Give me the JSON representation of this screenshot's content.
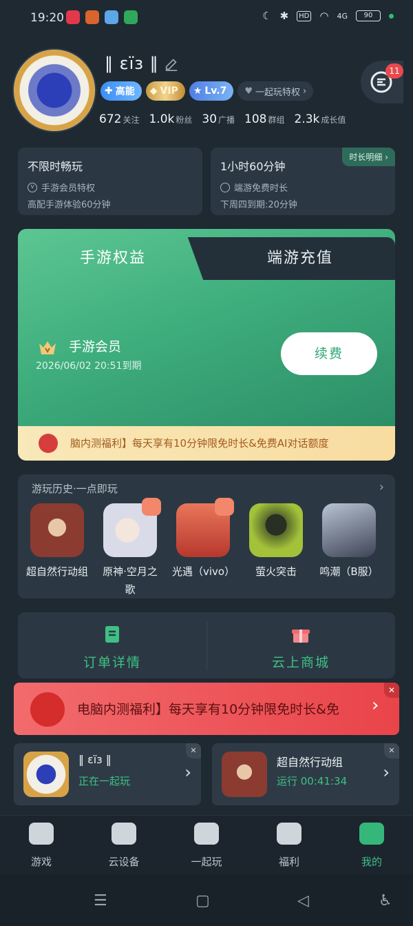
{
  "status_bar": {
    "time": "19:20",
    "signal": "4G",
    "battery": "90",
    "hd": "HD"
  },
  "profile": {
    "username": "‖ εïз ‖",
    "badges": {
      "gaoneng": "高能",
      "vip": "VIP",
      "level": "Lv.7",
      "privilege": "一起玩特权"
    },
    "stats": [
      {
        "value": "672",
        "label": "关注"
      },
      {
        "value": "1.0k",
        "label": "粉丝"
      },
      {
        "value": "30",
        "label": "广播"
      },
      {
        "value": "108",
        "label": "群组"
      },
      {
        "value": "2.3k",
        "label": "成长值"
      }
    ],
    "message_count": "11"
  },
  "cards": {
    "left": {
      "title": "不限时畅玩",
      "line1": "手游会员特权",
      "line2": "高配手游体验60分钟"
    },
    "right": {
      "tag": "时长明细",
      "title": "1小时60分钟",
      "line1": "端游免费时长",
      "line2": "下周四到期:20分钟"
    }
  },
  "benefits": {
    "tab_active": "手游权益",
    "tab_inactive": "端游充值",
    "member_title": "手游会员",
    "member_expire": "2026/06/02 20:51到期",
    "renew_label": "续费",
    "promo_text": "脑内测福利】每天享有10分钟限免时长&免费AI对话额度"
  },
  "history": {
    "title": "游玩历史·一点即玩",
    "games": [
      {
        "name": "超自然行动组",
        "color": "#8b3b30",
        "gift": false
      },
      {
        "name": "原神·空月之歌",
        "color": "#d9dbe8",
        "gift": true
      },
      {
        "name": "光遇（vivo）",
        "color": "#d45a4a",
        "gift": true
      },
      {
        "name": "萤火突击",
        "color": "#5a6b2c",
        "gift": false
      },
      {
        "name": "鸣潮（B服）",
        "color": "#3d4455",
        "gift": false
      }
    ]
  },
  "actions": {
    "order_label": "订单详情",
    "mall_label": "云上商城"
  },
  "red_banner": {
    "text": "电脑内测福利】每天享有10分钟限免时长&免",
    "close": "✕"
  },
  "playing": {
    "left": {
      "title": "‖ εïз ‖",
      "sub": "正在一起玩"
    },
    "right": {
      "title": "超自然行动组",
      "sub": "运行 00:41:34"
    }
  },
  "nav": [
    {
      "label": "游戏",
      "icon": "gamepad-icon",
      "active": false
    },
    {
      "label": "云设备",
      "icon": "cloud-device-icon",
      "active": false
    },
    {
      "label": "一起玩",
      "icon": "tv-icon",
      "active": false
    },
    {
      "label": "福利",
      "icon": "gift-icon",
      "active": false
    },
    {
      "label": "我的",
      "icon": "user-icon",
      "active": true
    }
  ],
  "colors": {
    "accent": "#3ec085",
    "background": "#1f2932",
    "banner_red": "#e9444a"
  }
}
